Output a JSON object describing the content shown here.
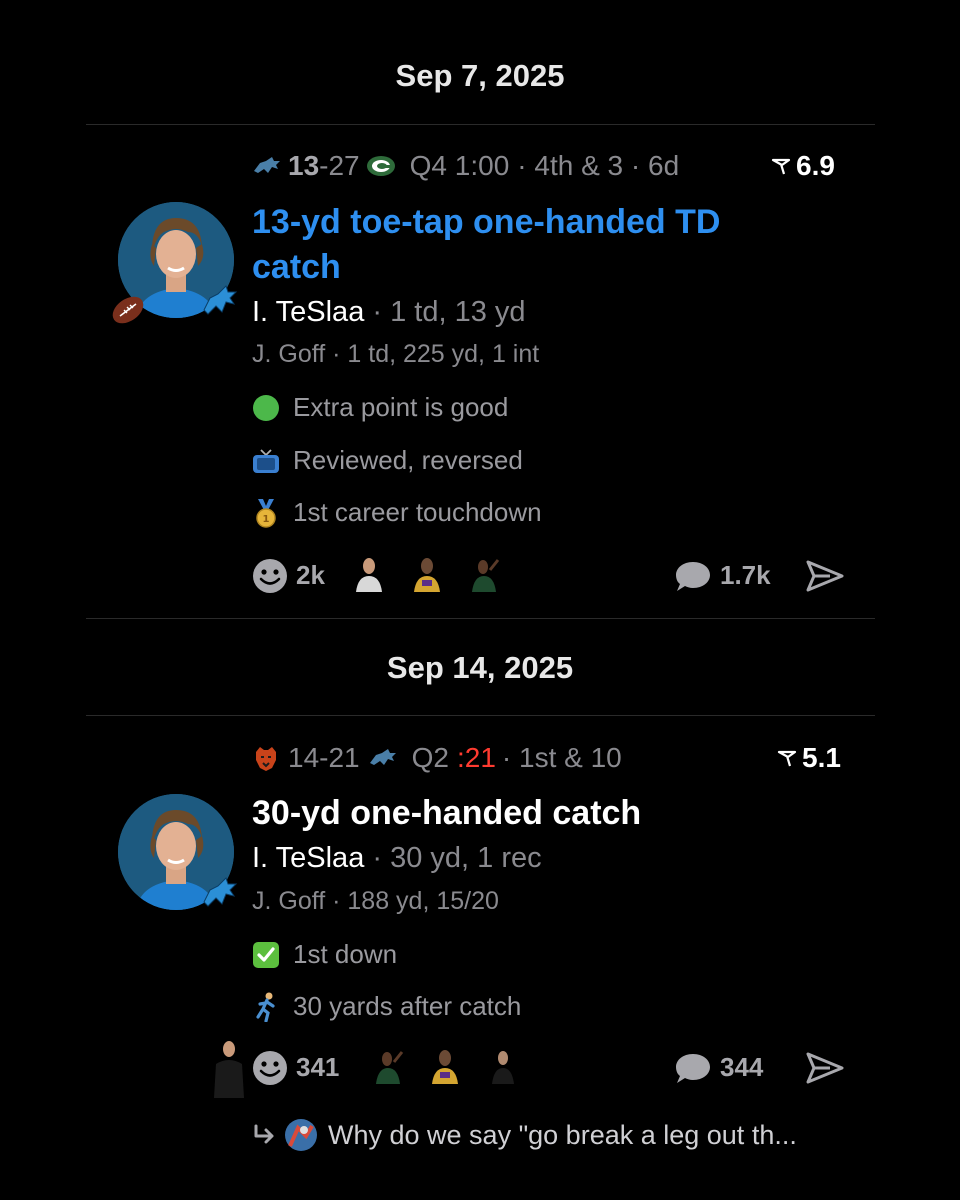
{
  "posts": [
    {
      "date": "Sep 7, 2025",
      "score_left": "13",
      "score_sep": "-",
      "score_right": "27",
      "clock": "Q4 1:00",
      "situation": "· 4th & 3 · 6d",
      "rating": "6.9",
      "title": "13-yd toe-tap one-handed TD catch",
      "player": "I. TeSlaa",
      "player_stats": " · 1 td, 13 yd",
      "passer": "J. Goff · 1 td, 225 yd, 1 int",
      "notes": [
        "Extra point is good",
        "Reviewed, reversed",
        "1st career touchdown"
      ],
      "reactions": "2k",
      "comments": "1.7k",
      "accent": "#2e8ff0"
    },
    {
      "date": "Sep 14, 2025",
      "score_left": "14-21",
      "quarter": "Q2",
      "clock_red": ":21",
      "situation": "· 1st & 10",
      "rating": "5.1",
      "title": "30-yd one-handed catch",
      "player": "I. TeSlaa",
      "player_stats": " · 30 yd, 1 rec",
      "passer": "J. Goff · 188 yd, 15/20",
      "notes": [
        "1st down",
        "30 yards after catch"
      ],
      "reactions": "341",
      "comments": "344",
      "reply": "Why do we say \"go break a leg out th..."
    }
  ],
  "icons": {
    "lions": "lions-logo-icon",
    "packers": "packers-logo-icon",
    "bears": "bears-logo-icon",
    "rating": "arrow-rating-icon",
    "reaction": "smiley-icon",
    "comment": "speech-bubble-icon",
    "share": "send-arrow-icon",
    "football": "football-icon",
    "green_circle": "green-circle-icon",
    "tv": "tv-icon",
    "medal": "medal-icon",
    "check": "check-box-icon",
    "runner": "runner-icon",
    "reply": "reply-arrow-icon"
  },
  "colors": {
    "background": "#000000",
    "link_blue": "#2e8ff0",
    "muted": "#8a8a8f",
    "red": "#ff3b30",
    "lions_blue": "#0076b6"
  }
}
